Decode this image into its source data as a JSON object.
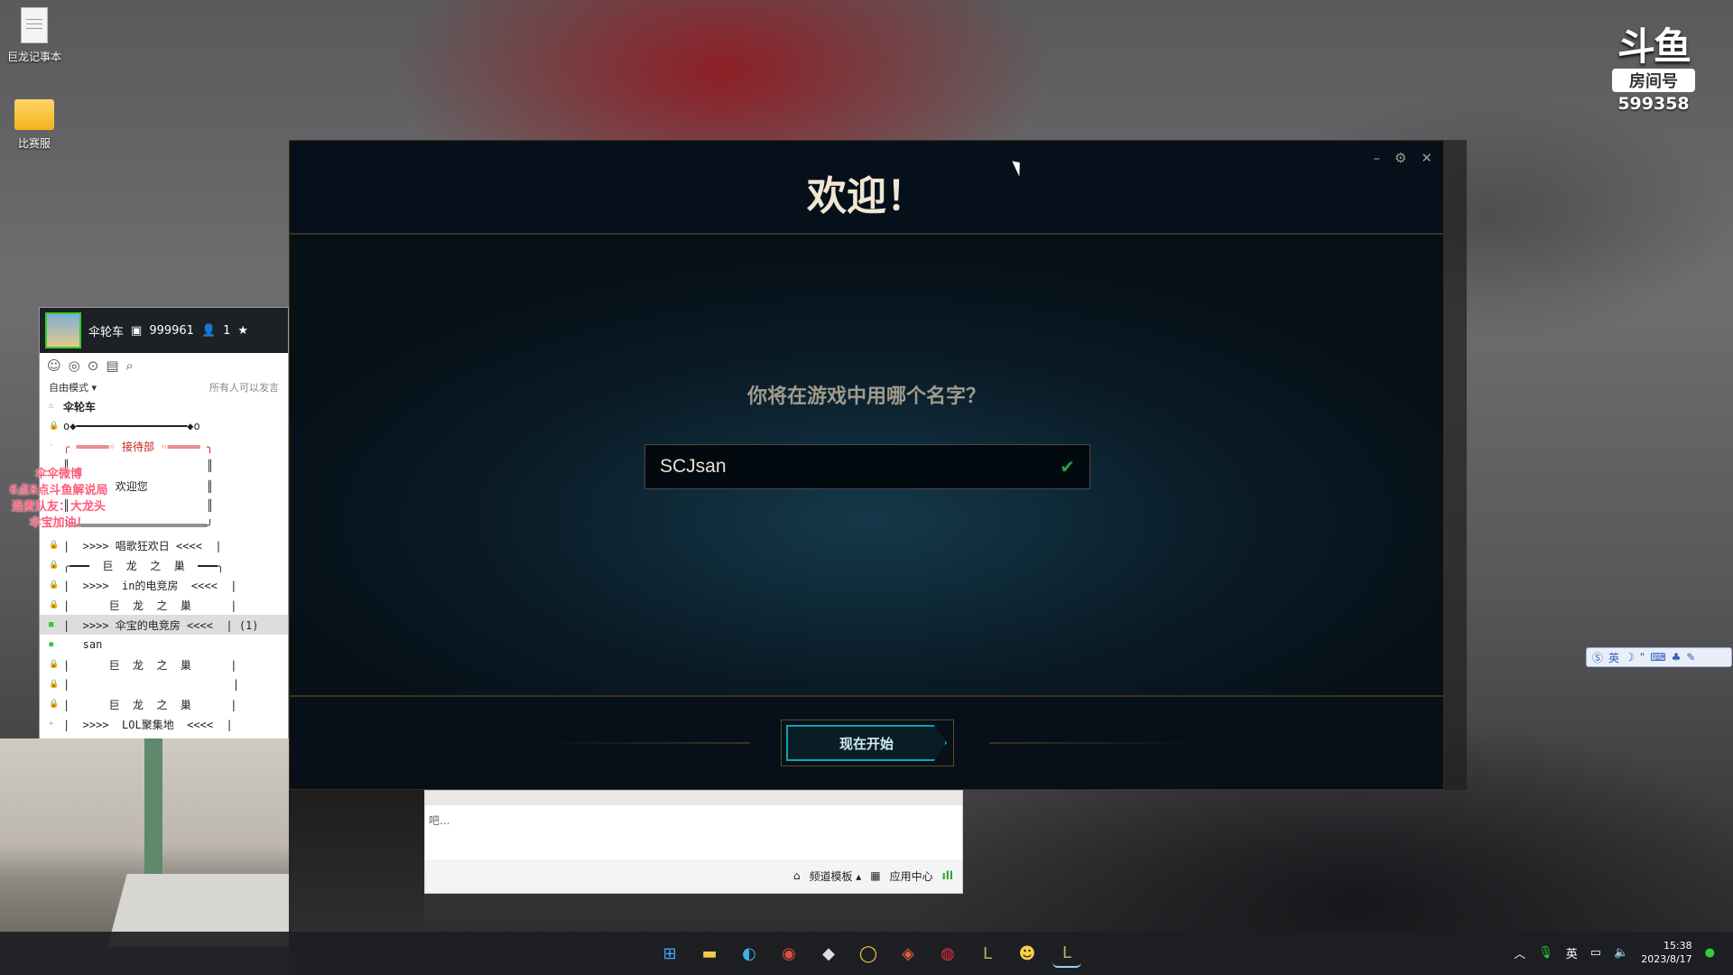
{
  "desktop": {
    "icons": [
      {
        "label": "巨龙记事本"
      },
      {
        "label": "比赛服"
      }
    ]
  },
  "douyu": {
    "logo": "斗鱼",
    "room_label": "房间号",
    "room_number": "599358"
  },
  "yy": {
    "channel_name": "伞轮车",
    "channel_id": "999961",
    "member_count": "1",
    "mode": "自由模式",
    "speak_setting": "所有人可以发言",
    "rows": [
      "伞轮车",
      "o◆━━━━━━━━━━━━━━━━━◆o",
      "╭ ═════◦ 接待部 ◦═════ ╮",
      "║                     ║",
      "        欢迎您         ║",
      "║                     ║",
      "╰═════════════════════╯",
      "|  >>>> 唱歌狂欢日 <<<<  |",
      "╭━━━  巨  龙  之  巢  ━━━╮",
      "|  >>>>  in的电竞房  <<<<  |",
      "|      巨  龙  之  巢      |",
      "|  >>>> 伞宝的电竞房 <<<<  | (1)",
      "   san",
      "|      巨  龙  之  巢      |",
      "|                         |",
      "|      巨  龙  之  巢      |",
      "|  >>>>  LOL聚集地  <<<<  |"
    ]
  },
  "overlay": {
    "lines": [
      "伞伞微博",
      "6点8点斗鱼解说局",
      "连麦队友：大龙头",
      "伞宝加油！"
    ]
  },
  "chat": {
    "input_text": "吧...",
    "channel_template": "频道模板",
    "app_center": "应用中心"
  },
  "lol": {
    "title": "欢迎！",
    "question": "你将在游戏中用哪个名字？",
    "name_value": "SCJsan",
    "start_button": "现在开始"
  },
  "ime": {
    "lang": "英"
  },
  "taskbar": {
    "lang": "英",
    "time": "15:38",
    "date": "2023/8/17"
  }
}
